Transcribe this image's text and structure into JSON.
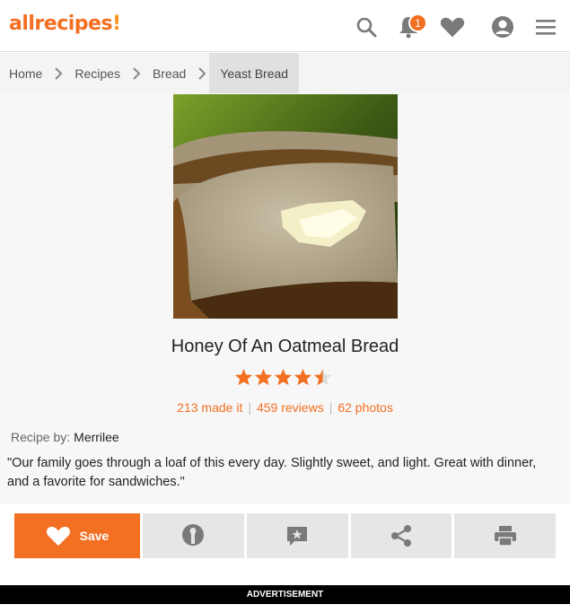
{
  "header": {
    "logo_text": "allrecipes",
    "notification_count": "1",
    "icons": [
      "search-icon",
      "bell-icon",
      "heart-icon",
      "profile-icon",
      "menu-icon"
    ]
  },
  "breadcrumb": {
    "items": [
      "Home",
      "Recipes",
      "Bread",
      "Yeast Bread"
    ]
  },
  "recipe": {
    "title": "Honey Of An Oatmeal Bread",
    "rating": 4.5,
    "made_it": "213 made it",
    "reviews": "459 reviews",
    "photos": "62 photos",
    "byline_label": "Recipe by:",
    "author": "Merrilee",
    "description": "\"Our family goes through a loaf of this every day. Slightly sweet, and light. Great with dinner, and a favorite for sandwiches.\""
  },
  "actions": {
    "save_label": "Save",
    "icons": [
      "heart-icon",
      "made-it-icon",
      "review-icon",
      "share-icon",
      "print-icon"
    ]
  },
  "ad": {
    "label": "ADVERTISEMENT"
  },
  "colors": {
    "brand": "#f36f21",
    "star": "#f36f21"
  }
}
